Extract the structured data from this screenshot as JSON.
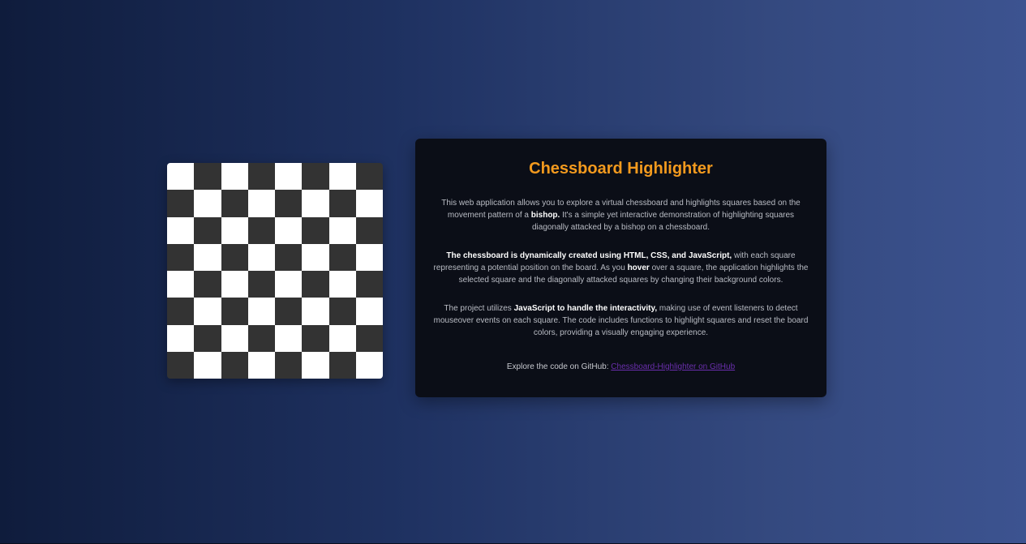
{
  "colors": {
    "accent": "#f39a1e",
    "link": "#6b2fae",
    "panel_bg": "#0b0e17",
    "light_square": "#ffffff",
    "dark_square": "#333333"
  },
  "board": {
    "rows": 8,
    "cols": 8
  },
  "panel": {
    "title": "Chessboard Highlighter",
    "p1": {
      "t1": "This web application allows you to explore a virtual chessboard and highlights squares based on the movement pattern of a ",
      "b1": "bishop.",
      "t2": " It's a simple yet interactive demonstration of highlighting squares diagonally attacked by a bishop on a chessboard."
    },
    "p2": {
      "b1": "The chessboard is dynamically created using HTML, CSS, and JavaScript,",
      "t1": " with each square representing a potential position on the board. As you ",
      "b2": "hover",
      "t2": " over a square, the application highlights the selected square and the diagonally attacked squares by changing their background colors."
    },
    "p3": {
      "t1": "The project utilizes ",
      "b1": "JavaScript to handle the interactivity,",
      "t2": " making use of event listeners to detect mouseover events on each square. The code includes functions to highlight squares and reset the board colors, providing a visually engaging experience."
    },
    "github": {
      "prefix": "Explore the code on GitHub: ",
      "link_text": "Chessboard-Highlighter on GitHub"
    }
  }
}
